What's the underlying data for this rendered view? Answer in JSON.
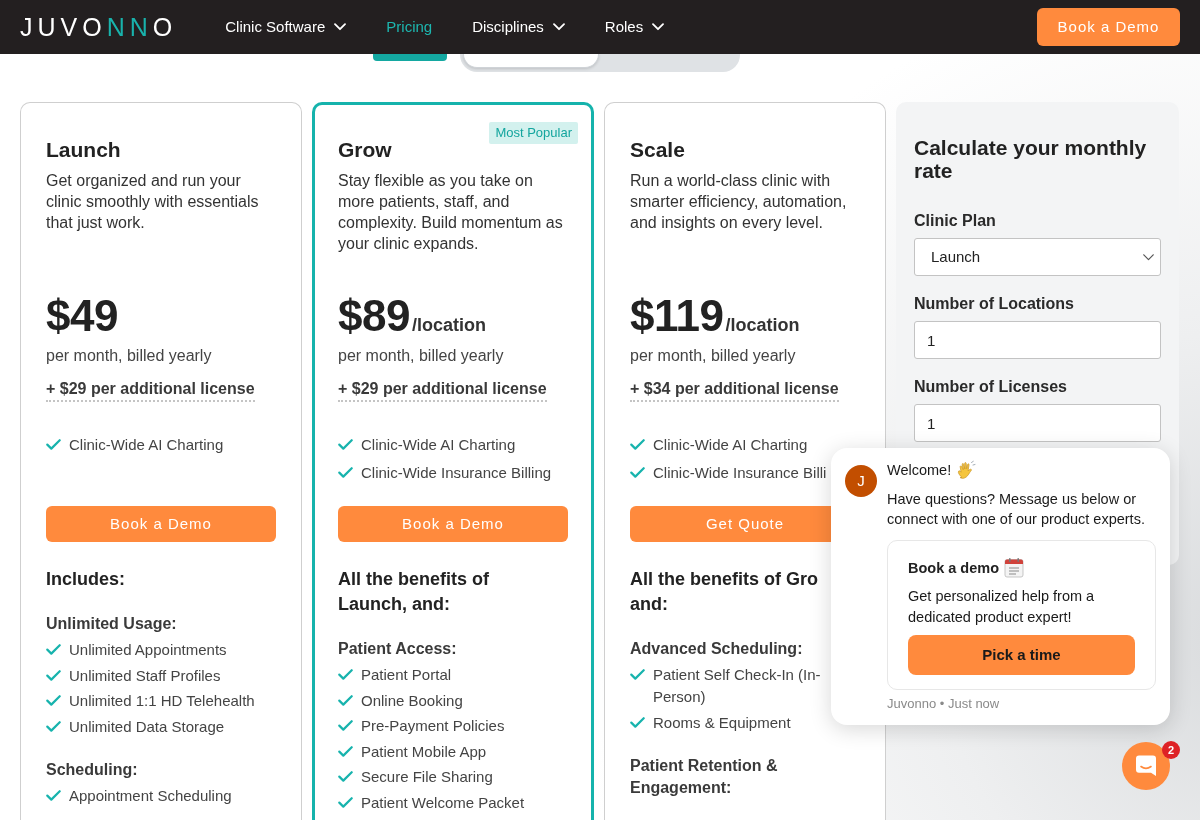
{
  "navbar": {
    "logo": [
      {
        "text": "JUVO",
        "accent": false
      },
      {
        "text": "NN",
        "accent": true
      },
      {
        "text": "O",
        "accent": false
      }
    ],
    "links": [
      {
        "label": "Clinic Software",
        "dropdown": true,
        "selected": false
      },
      {
        "label": "Pricing",
        "dropdown": false,
        "selected": true
      },
      {
        "label": "Disciplines",
        "dropdown": true,
        "selected": false
      },
      {
        "label": "Roles",
        "dropdown": true,
        "selected": false
      }
    ],
    "cta": "Book a Demo"
  },
  "billing_toggle": {
    "options": [
      {
        "selected": true
      },
      {
        "selected": false
      }
    ]
  },
  "plans": [
    {
      "name": "Launch",
      "highlighted": false,
      "description": "Get organized and run your clinic smoothly with essentials that just work.",
      "price": "$49",
      "billing": "per month, billed yearly",
      "extra_license": "+ $29 per additional license",
      "features": [
        "Clinic-Wide AI Charting"
      ],
      "button": "Book a Demo",
      "heading_lines": [
        "Includes:"
      ],
      "groups": [
        {
          "title": "Unlimited Usage:",
          "items": [
            "Unlimited Appointments",
            "Unlimited Staff Profiles",
            "Unlimited 1:1 HD Telehealth",
            "Unlimited Data Storage"
          ]
        },
        {
          "title": "Scheduling:",
          "items": [
            "Appointment Scheduling"
          ]
        }
      ]
    },
    {
      "name": "Grow",
      "highlighted": true,
      "badge": "Most Popular",
      "description": "Stay flexible as you take on more patients, staff, and complexity. Build momentum as your clinic expands.",
      "price": "$89",
      "unit": "/location",
      "billing": "per month, billed yearly",
      "extra_license": "+ $29 per additional license",
      "features": [
        "Clinic-Wide AI Charting",
        "Clinic-Wide Insurance Billing"
      ],
      "button": "Book a Demo",
      "heading_lines": [
        "All the benefits of",
        "Launch, and:"
      ],
      "groups": [
        {
          "title": "Patient Access:",
          "items": [
            "Patient Portal",
            "Online Booking",
            "Pre-Payment Policies",
            "Patient Mobile App",
            "Secure File Sharing",
            "Patient Welcome Packet"
          ]
        }
      ]
    },
    {
      "name": "Scale",
      "highlighted": false,
      "description": "Run a world-class clinic with smarter efficiency, automation, and insights on every level.",
      "price": "$119",
      "unit": "/location",
      "billing": "per month, billed yearly",
      "extra_license": "+ $34 per additional license",
      "features": [
        "Clinic-Wide AI Charting",
        "Clinic-Wide Insurance Billi"
      ],
      "button": "Get Quote",
      "heading_lines": [
        "All the benefits of Gro",
        "and:"
      ],
      "groups": [
        {
          "title": "Advanced Scheduling:",
          "items": [
            "Patient Self Check-In (In-Person)",
            "Rooms & Equipment"
          ]
        },
        {
          "title": "Patient Retention & Engagement:"
        }
      ]
    }
  ],
  "calculator": {
    "title": "Calculate your monthly rate",
    "fields": [
      {
        "kind": "select",
        "label": "Clinic Plan",
        "value": "Launch"
      },
      {
        "kind": "number",
        "label": "Number of Locations",
        "value": "1"
      },
      {
        "kind": "number",
        "label": "Number of Licenses",
        "value": "1"
      }
    ]
  },
  "chat_popup": {
    "avatar": "J",
    "greeting": "Welcome!",
    "message": "Have questions? Message us below or connect with one of our product experts.",
    "card": {
      "title": "Book a demo",
      "text": "Get personalized help from a dedicated product expert!",
      "button": "Pick a time"
    },
    "meta": "Juvonno • Just now"
  },
  "chat_launcher": {
    "unread_count": "2"
  }
}
